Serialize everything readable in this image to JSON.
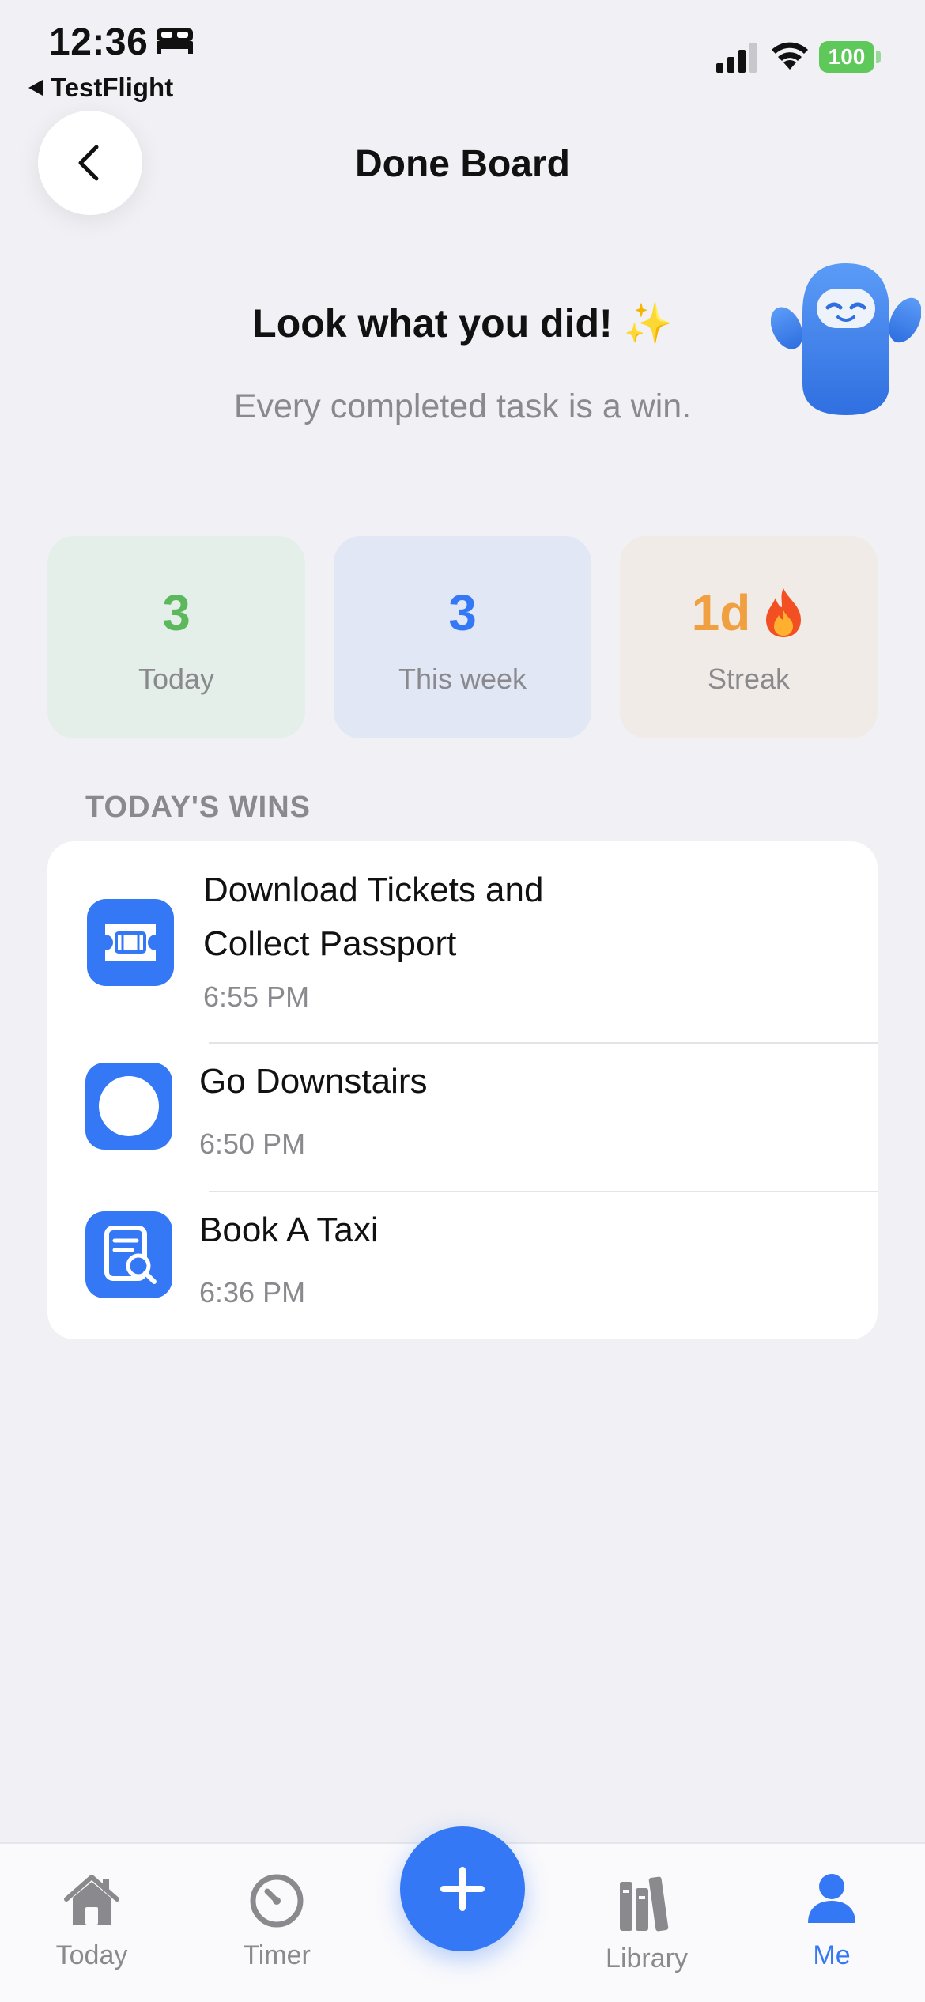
{
  "status_bar": {
    "time": "12:36",
    "back_app": "TestFlight",
    "battery": "100"
  },
  "header": {
    "title": "Done Board"
  },
  "hero": {
    "title": "Look what you did! ✨",
    "subtitle": "Every completed task is a win."
  },
  "stats": {
    "today": {
      "value": "3",
      "label": "Today"
    },
    "week": {
      "value": "3",
      "label": "This week"
    },
    "streak": {
      "value": "1d",
      "label": "Streak"
    }
  },
  "section": {
    "label": "TODAY'S WINS"
  },
  "wins": [
    {
      "title_line1": "Download Tickets and",
      "title_line2": "Collect Passport",
      "time": "6:55 PM",
      "icon": "ticket-icon"
    },
    {
      "title": "Go Downstairs",
      "time": "6:50 PM",
      "icon": "circle-icon"
    },
    {
      "title": "Book A Taxi",
      "time": "6:36 PM",
      "icon": "document-search-icon"
    }
  ],
  "tabbar": {
    "today": "Today",
    "timer": "Timer",
    "library": "Library",
    "me": "Me",
    "active": "Me"
  },
  "colors": {
    "accent": "#3478f6",
    "green": "#5cb85c",
    "orange": "#f0a040",
    "background": "#f0f0f5"
  }
}
